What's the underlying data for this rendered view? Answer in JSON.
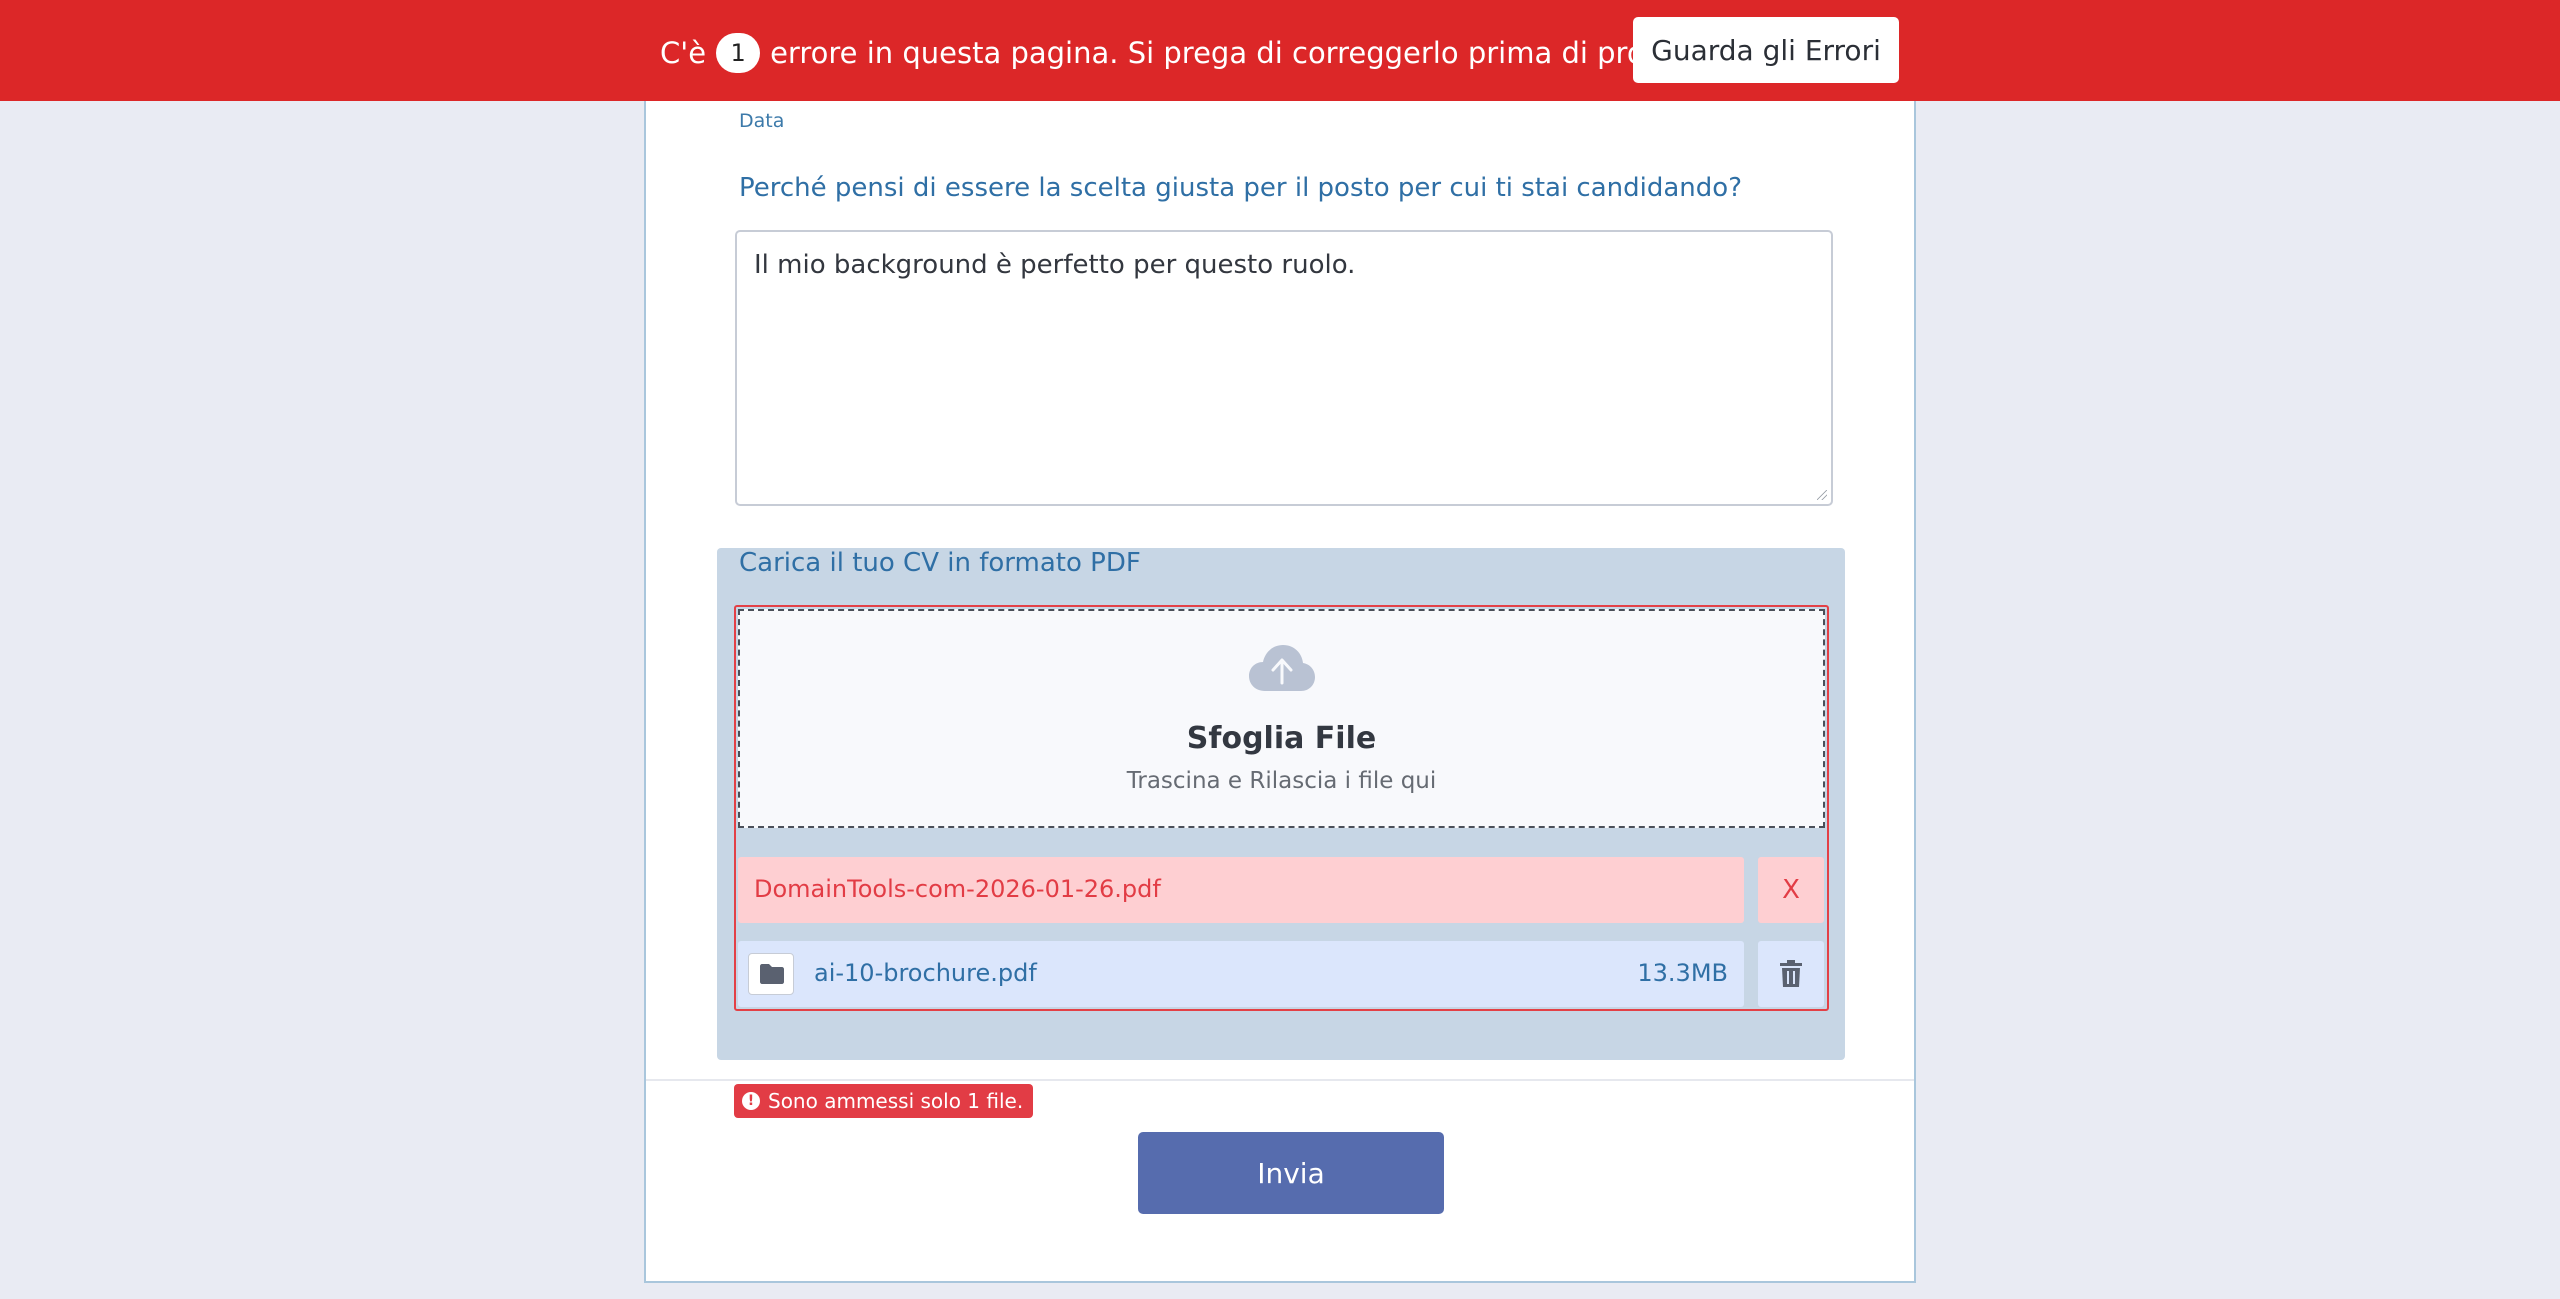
{
  "banner": {
    "text_before": "C'è",
    "error_count": "1",
    "text_after": "errore in questa pagina. Si prega di correggerlo prima di procedere.",
    "view_errors_label": "Guarda gli Errori"
  },
  "form": {
    "date_label": "Data",
    "question": "Perché pensi di essere la scelta giusta per il posto per cui ti stai candidando?",
    "answer": "Il mio background è perfetto per questo ruolo.",
    "upload": {
      "label": "Carica il tuo CV in formato PDF",
      "browse_title": "Sfoglia File",
      "drop_hint": "Trascina e Rilascia i file qui",
      "files": [
        {
          "name": "DomainTools-com-2026-01-26.pdf",
          "status": "error",
          "remove_label": "X"
        },
        {
          "name": "ai-10-brochure.pdf",
          "size": "13.3MB",
          "status": "ok"
        }
      ],
      "error_message": "Sono ammessi solo 1 file."
    },
    "submit_label": "Invia"
  },
  "colors": {
    "banner_red": "#dc2728",
    "accent_blue": "#2f6fa5",
    "submit_button": "#566cae",
    "error_red": "#e23c45",
    "error_row_bg": "#fecfd2",
    "ok_row_bg": "#dbe6fc"
  },
  "icons": [
    "upload-cloud-icon",
    "folder-icon",
    "trash-icon",
    "alert-circle-icon"
  ]
}
